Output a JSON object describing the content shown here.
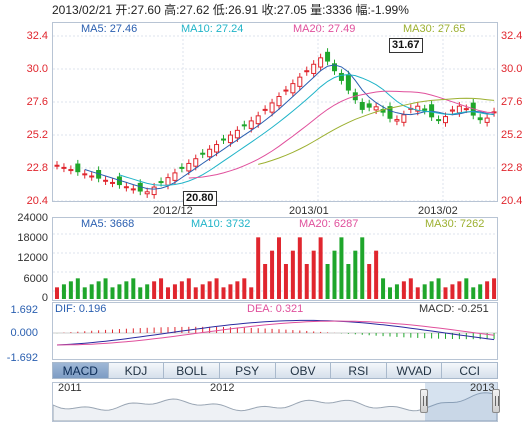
{
  "header": {
    "text": "2013/02/21 开:27.60 高:27.62 低:26.91 收:27.05 量:3336 幅:-1.99%"
  },
  "price": {
    "ma5": "MA5: 27.46",
    "ma10": "MA10: 27.24",
    "ma20": "MA20: 27.49",
    "ma30": "MA30: 27.65",
    "yticks": [
      "32.4",
      "30.0",
      "27.6",
      "25.2",
      "22.8",
      "20.4"
    ],
    "high_label": "31.67",
    "low_label": "20.80",
    "dates": [
      "2012/12",
      "2013/01",
      "2013/02"
    ],
    "colors": {
      "up": "#e0262e",
      "down": "#1fa62b",
      "ma5": "#2a5fb0",
      "ma10": "#20b4c8",
      "ma20": "#e0509c",
      "ma30": "#9cb030"
    }
  },
  "volume": {
    "ma5": "MA5: 3668",
    "ma10": "MA10: 3732",
    "ma20": "MA20: 6287",
    "ma30": "MA30: 7262",
    "yticks": [
      "24000",
      "18000",
      "12000",
      "6000",
      "0"
    ]
  },
  "macd": {
    "dif": "DIF: 0.196",
    "dea": "DEA: 0.321",
    "macd": "MACD: -0.251",
    "yticks": [
      "1.692",
      "0.000",
      "-1.692"
    ]
  },
  "tabs": [
    "MACD",
    "KDJ",
    "BOLL",
    "PSY",
    "OBV",
    "RSI",
    "WVAD",
    "CCI"
  ],
  "navigator": {
    "labels": [
      "2011",
      "2012",
      "2013"
    ]
  }
}
